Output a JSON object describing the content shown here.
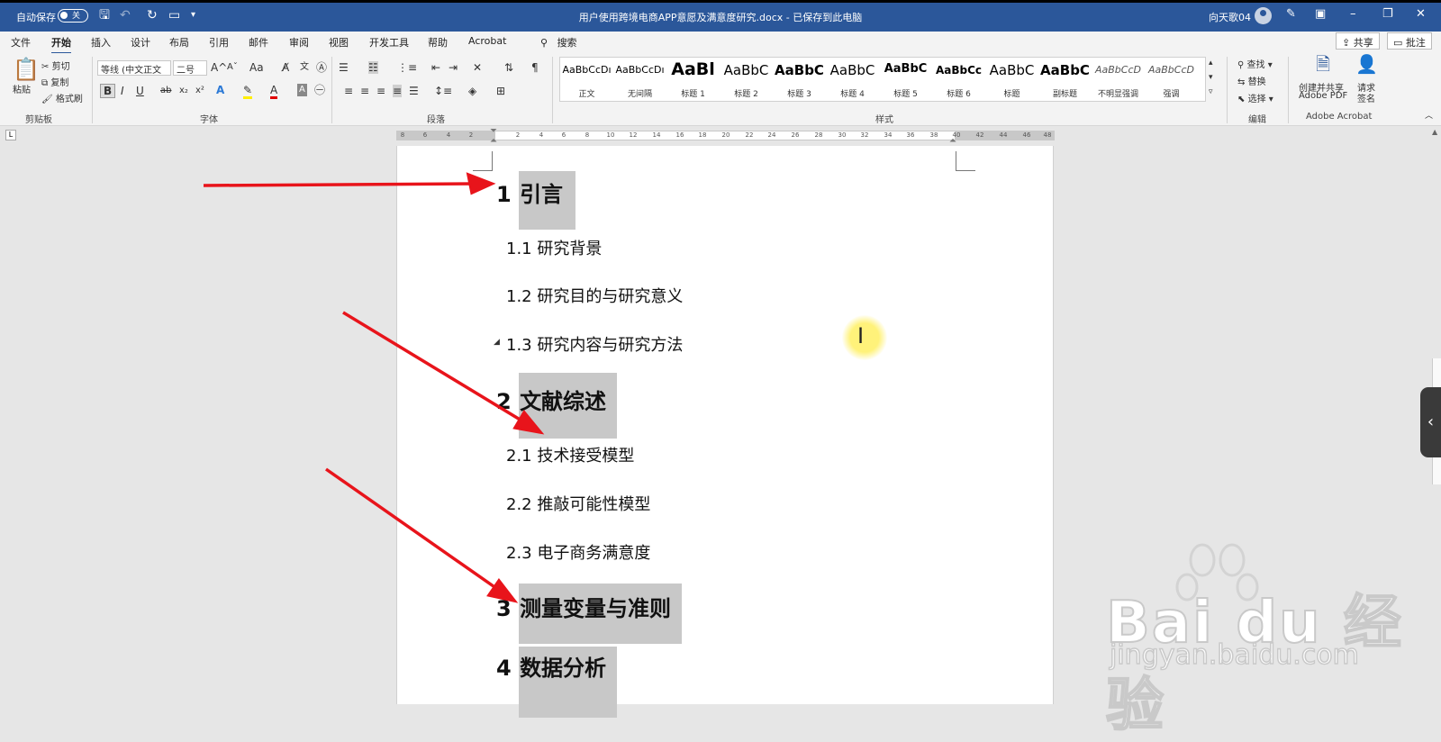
{
  "titlebar": {
    "autosave": "自动保存",
    "autosave_state": "关",
    "doc_title": "用户使用跨境电商APP意愿及满意度研究.docx - 已保存到此电脑",
    "user": "向天歌04",
    "bg_color": "#2b579a"
  },
  "menu": {
    "tabs": [
      "文件",
      "开始",
      "插入",
      "设计",
      "布局",
      "引用",
      "邮件",
      "审阅",
      "视图",
      "开发工具",
      "帮助",
      "Acrobat"
    ],
    "active_tab": "开始",
    "search_label": "搜索",
    "share": "共享",
    "comment": "批注"
  },
  "ribbon": {
    "clipboard": {
      "paste": "粘贴",
      "cut": "剪切",
      "copy": "复制",
      "format_painter": "格式刷",
      "label": "剪贴板"
    },
    "font": {
      "font_name": "等线 (中文正文",
      "font_size": "二号",
      "label": "字体"
    },
    "paragraph": {
      "label": "段落"
    },
    "styles": {
      "label": "样式",
      "items": [
        {
          "sample": "AaBbCcDı",
          "name": "正文"
        },
        {
          "sample": "AaBbCcDı",
          "name": "无间隔"
        },
        {
          "sample": "AaBl",
          "name": "标题 1"
        },
        {
          "sample": "AaBbC",
          "name": "标题 2"
        },
        {
          "sample": "AaBbC",
          "name": "标题 3"
        },
        {
          "sample": "AaBbC",
          "name": "标题 4"
        },
        {
          "sample": "AaBbC",
          "name": "标题 5"
        },
        {
          "sample": "AaBbCc",
          "name": "标题 6"
        },
        {
          "sample": "AaBbC",
          "name": "标题"
        },
        {
          "sample": "AaBbC",
          "name": "副标题"
        },
        {
          "sample": "AaBbCcD",
          "name": "不明显强调"
        },
        {
          "sample": "AaBbCcD",
          "name": "强调"
        }
      ]
    },
    "editing": {
      "find": "查找",
      "replace": "替换",
      "select": "选择",
      "label": "编辑"
    },
    "acrobat": {
      "create_share": "创建并共享",
      "create_share_2": "Adobe PDF",
      "request_sign": "请求",
      "request_sign_2": "签名",
      "label": "Adobe Acrobat"
    }
  },
  "ruler": {
    "ticks": [
      "8",
      "6",
      "4",
      "2",
      "2",
      "4",
      "6",
      "8",
      "10",
      "12",
      "14",
      "16",
      "18",
      "20",
      "22",
      "24",
      "26",
      "28",
      "30",
      "32",
      "34",
      "36",
      "38",
      "40",
      "42",
      "44",
      "46",
      "48"
    ]
  },
  "document": {
    "headings": [
      {
        "num": "1",
        "text": "引言"
      },
      {
        "num": "2",
        "text": "文献综述"
      },
      {
        "num": "3",
        "text": "测量变量与准则"
      },
      {
        "num": "4",
        "text": "数据分析"
      }
    ],
    "subheadings": [
      "1.1 研究背景",
      "1.2 研究目的与研究意义",
      "1.3 研究内容与研究方法",
      "2.1 技术接受模型",
      "2.2 推敲可能性模型",
      "2.3 电子商务满意度"
    ]
  },
  "watermark": {
    "brand": "Bai du 经验",
    "url": "jingyan.baidu.com"
  }
}
